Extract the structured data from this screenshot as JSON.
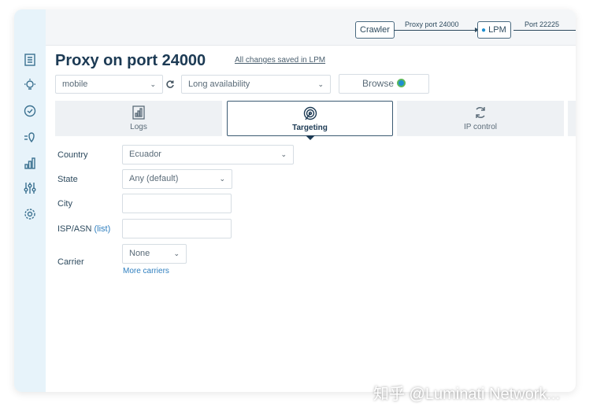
{
  "flow": {
    "crawler": "Crawler",
    "proxy_port": "Proxy port 24000",
    "lpm": "LPM",
    "port_out": "Port 22225"
  },
  "header": {
    "title": "Proxy on port 24000",
    "saved_status": "All changes saved in LPM"
  },
  "toolbar": {
    "preset_select": "mobile",
    "session_select": "Long availability",
    "browse_label": "Browse"
  },
  "tabs": [
    {
      "label": "Logs",
      "icon": "logs-icon"
    },
    {
      "label": "Targeting",
      "icon": "targeting-icon",
      "active": true
    },
    {
      "label": "IP control",
      "icon": "ip-control-icon"
    }
  ],
  "form": {
    "country_label": "Country",
    "country_value": "Ecuador",
    "state_label": "State",
    "state_value": "Any (default)",
    "city_label": "City",
    "isp_label": "ISP/ASN",
    "isp_link": "(list)",
    "carrier_label": "Carrier",
    "carrier_value": "None",
    "more_carriers": "More carriers"
  },
  "watermark": "知乎 @Luminati Network...",
  "colors": {
    "sidebar_bg": "#e7f3fa",
    "title": "#1c3a54",
    "link": "#2f7fbf"
  }
}
